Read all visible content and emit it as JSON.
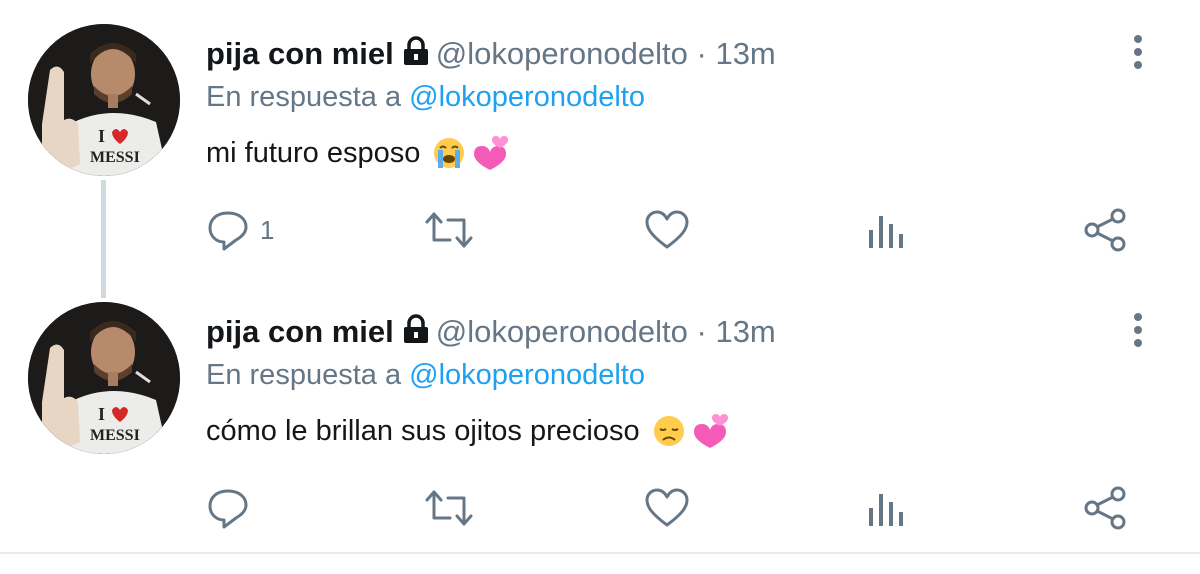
{
  "tweets": [
    {
      "display_name": "pija con miel",
      "handle": "@lokoperonodelto",
      "separator": "·",
      "time": "13m",
      "reply_prefix": "En respuesta a",
      "reply_mention": "@lokoperonodelto",
      "text": "mi futuro esposo",
      "emojis": [
        "loudly-crying-face",
        "two-hearts"
      ],
      "reply_count": "1",
      "avatar_shirt_text_line1": "I",
      "avatar_shirt_text_line2": "MESSI"
    },
    {
      "display_name": "pija con miel",
      "handle": "@lokoperonodelto",
      "separator": "·",
      "time": "13m",
      "reply_prefix": "En respuesta a",
      "reply_mention": "@lokoperonodelto",
      "text": "cómo le brillan sus ojitos precioso",
      "emojis": [
        "disappointed-face",
        "two-hearts"
      ],
      "reply_count": "",
      "avatar_shirt_text_line1": "I",
      "avatar_shirt_text_line2": "MESSI"
    }
  ],
  "icons": {
    "lock": "lock-icon",
    "more": "more-vertical-icon",
    "reply": "reply-icon",
    "retweet": "retweet-icon",
    "like": "heart-icon",
    "analytics": "analytics-icon",
    "share": "share-icon"
  },
  "colors": {
    "link": "#1da1f2",
    "muted": "#657786",
    "text": "#14171a",
    "thread_line": "#cfd9de"
  }
}
